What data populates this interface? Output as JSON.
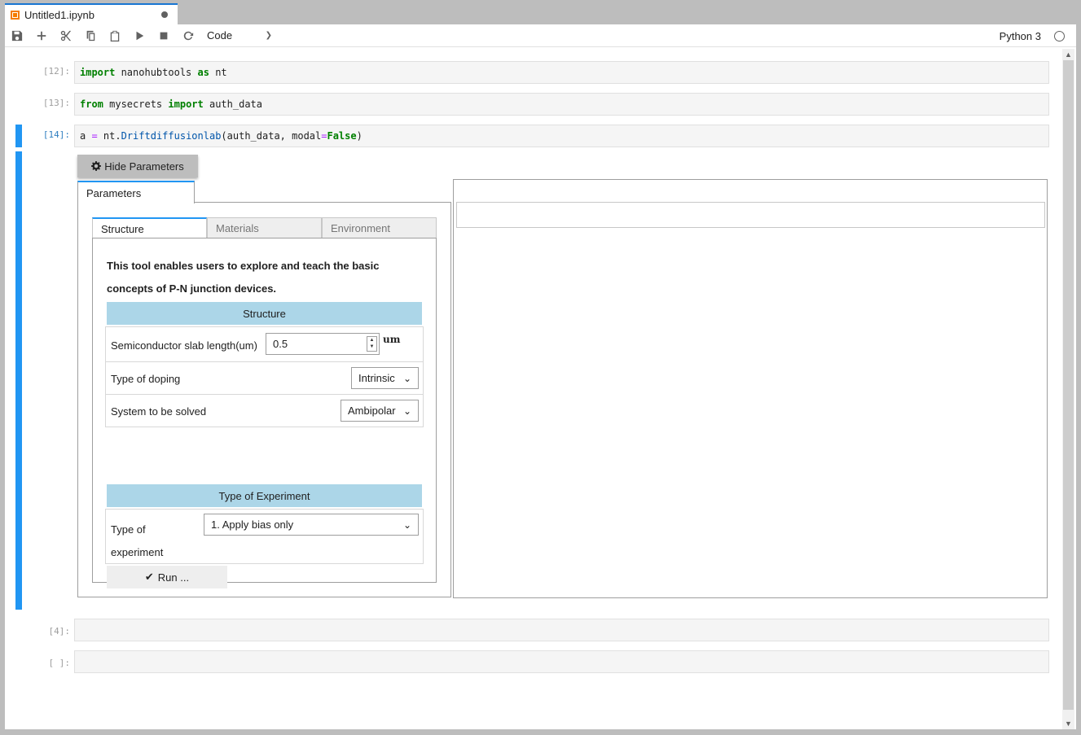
{
  "tab": {
    "title": "Untitled1.ipynb"
  },
  "toolbar": {
    "cell_type": "Code",
    "kernel_name": "Python 3"
  },
  "cells": [
    {
      "prompt": "[12]:",
      "code": "import nanohubtools as nt"
    },
    {
      "prompt": "[13]:",
      "code": "from mysecrets import auth_data"
    },
    {
      "prompt": "[14]:",
      "code": "a = nt.Driftdiffusionlab(auth_data, modal=False)"
    },
    {
      "prompt": "[4]:",
      "code": ""
    },
    {
      "prompt": "[ ]:",
      "code": ""
    }
  ],
  "widget": {
    "hide_button": "Hide Parameters",
    "outer_tab": "Parameters",
    "inner_tabs": [
      "Structure",
      "Materials",
      "Environment"
    ],
    "description": "This tool enables users to explore and teach the basic concepts of P-N junction devices.",
    "structure_header": "Structure",
    "slab_label": "Semiconductor slab length(um)",
    "slab_value": "0.5",
    "slab_unit": "um",
    "doping_label": "Type of doping",
    "doping_value": "Intrinsic",
    "system_label": "System to be solved",
    "system_value": "Ambipolar",
    "experiment_header": "Type of Experiment",
    "experiment_label": "Type of experiment",
    "experiment_value": "1. Apply bias only",
    "run_button": "Run ..."
  }
}
